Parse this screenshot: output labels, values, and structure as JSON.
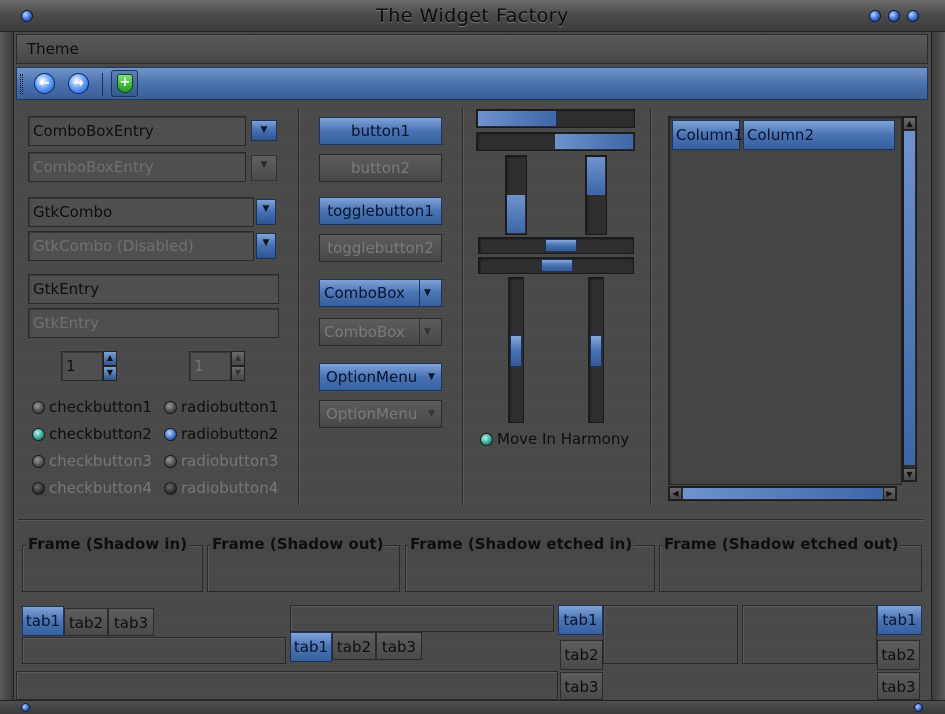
{
  "window": {
    "title": "The Widget Factory"
  },
  "menu": {
    "theme_label": "Theme"
  },
  "toolbar": {
    "back_icon": "back-arrow-icon",
    "forward_icon": "forward-arrow-icon",
    "shield_icon": "shield-plus-icon"
  },
  "left": {
    "combo_entry_1": "ComboBoxEntry",
    "combo_entry_2": "ComboBoxEntry",
    "gtk_combo_1": "GtkCombo",
    "gtk_combo_2": "GtkCombo (Disabled)",
    "entry_1": "GtkEntry",
    "entry_2": "GtkEntry",
    "spin_1": "1",
    "spin_2": "1",
    "checks": [
      "checkbutton1",
      "checkbutton2",
      "checkbutton3",
      "checkbutton4"
    ],
    "radios": [
      "radiobutton1",
      "radiobutton2",
      "radiobutton3",
      "radiobutton4"
    ]
  },
  "middle": {
    "button1": "button1",
    "button2": "button2",
    "toggle1": "togglebutton1",
    "toggle2": "togglebutton2",
    "combobox1": "ComboBox",
    "combobox2": "ComboBox",
    "optionmenu1": "OptionMenu",
    "optionmenu2": "OptionMenu"
  },
  "sliders": {
    "harmony_label": "Move In Harmony",
    "hprogress_1": 0.5,
    "hprogress_2": 0.5,
    "vprogress_1": 0.5,
    "vprogress_2": 0.5
  },
  "tree": {
    "columns": [
      "Column1",
      "Column2"
    ]
  },
  "frames": {
    "labels": [
      "Frame (Shadow in)",
      "Frame (Shadow out)",
      "Frame (Shadow etched in)",
      "Frame (Shadow etched out)"
    ]
  },
  "tabs": {
    "labels": [
      "tab1",
      "tab2",
      "tab3"
    ]
  },
  "colors": {
    "accent": "#4a73b4",
    "background": "#474747"
  }
}
